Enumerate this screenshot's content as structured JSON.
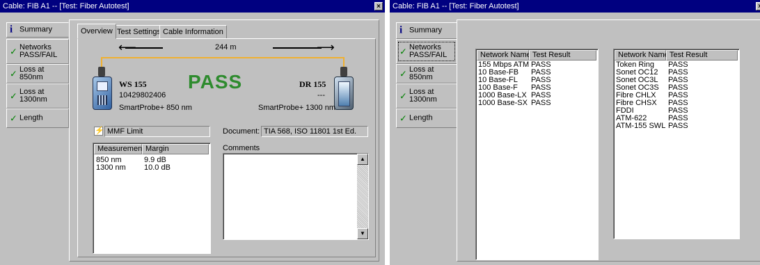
{
  "windows": {
    "left": {
      "title": "Cable: FIB A1 -- [Test: Fiber Autotest]",
      "close_glyph": "×",
      "sidebar": {
        "items": [
          {
            "label": "Summary",
            "icon": "info-icon",
            "icon_glyph": "i"
          },
          {
            "label": "Networks\nPASS/FAIL",
            "icon": "checkmark-icon",
            "icon_glyph": "✓"
          },
          {
            "label": "Loss at 850nm",
            "icon": "checkmark-icon",
            "icon_glyph": "✓"
          },
          {
            "label": "Loss at\n1300nm",
            "icon": "checkmark-icon",
            "icon_glyph": "✓"
          },
          {
            "label": "Length",
            "icon": "checkmark-icon",
            "icon_glyph": "✓"
          }
        ],
        "active_index": 0
      },
      "tabs": [
        "Overview",
        "Test Settings",
        "Cable Information"
      ],
      "active_tab": 0,
      "overview": {
        "length": "244 m",
        "result": "PASS",
        "left_device": {
          "name": "WS 155",
          "serial": "10429802406",
          "model": "SmartProbe+ 850 nm"
        },
        "right_device": {
          "name": "DR 155",
          "serial": "---",
          "model": "SmartProbe+ 1300 nm"
        },
        "limit_label": "MMF Limit",
        "document_label": "Document:",
        "document_value": "TIA 568, ISO 11801 1st Ed.",
        "comments_label": "Comments",
        "measurement_table": {
          "columns": [
            "Measurement",
            "Margin"
          ],
          "rows": [
            [
              "850 nm",
              "9.9 dB"
            ],
            [
              "1300 nm",
              "10.0 dB"
            ]
          ]
        }
      }
    },
    "right": {
      "title": "Cable: FIB A1 -- [Test: Fiber Autotest]",
      "close_glyph": "×",
      "sidebar": {
        "items": [
          {
            "label": "Summary",
            "icon": "info-icon",
            "icon_glyph": "i"
          },
          {
            "label": "Networks\nPASS/FAIL",
            "icon": "checkmark-icon",
            "icon_glyph": "✓"
          },
          {
            "label": "Loss at 850nm",
            "icon": "checkmark-icon",
            "icon_glyph": "✓"
          },
          {
            "label": "Loss at\n1300nm",
            "icon": "checkmark-icon",
            "icon_glyph": "✓"
          },
          {
            "label": "Length",
            "icon": "checkmark-icon",
            "icon_glyph": "✓"
          }
        ],
        "active_index": 1
      },
      "networks_tables": [
        {
          "columns": [
            "Network Name",
            "Test Result"
          ],
          "rows": [
            [
              "155 Mbps ATM",
              "PASS"
            ],
            [
              "10 Base-FB",
              "PASS"
            ],
            [
              "10 Base-FL",
              "PASS"
            ],
            [
              "100 Base-F",
              "PASS"
            ],
            [
              "1000 Base-LX",
              "PASS"
            ],
            [
              "1000 Base-SX",
              "PASS"
            ]
          ]
        },
        {
          "columns": [
            "Network Name",
            "Test Result"
          ],
          "rows": [
            [
              "Token Ring",
              "PASS"
            ],
            [
              "Sonet OC12",
              "PASS"
            ],
            [
              "Sonet OC3L",
              "PASS"
            ],
            [
              "Sonet OC3S",
              "PASS"
            ],
            [
              "Fibre CHLX",
              "PASS"
            ],
            [
              "Fibre CHSX",
              "PASS"
            ],
            [
              "FDDI",
              "PASS"
            ],
            [
              "ATM-622",
              "PASS"
            ],
            [
              "ATM-155 SWL",
              "PASS"
            ]
          ]
        }
      ]
    }
  },
  "colors": {
    "title_bar": "#000080",
    "face": "#c0c0c0",
    "pass_text": "#2e8b2e",
    "check": "#008000",
    "cable": "#f0b030"
  }
}
